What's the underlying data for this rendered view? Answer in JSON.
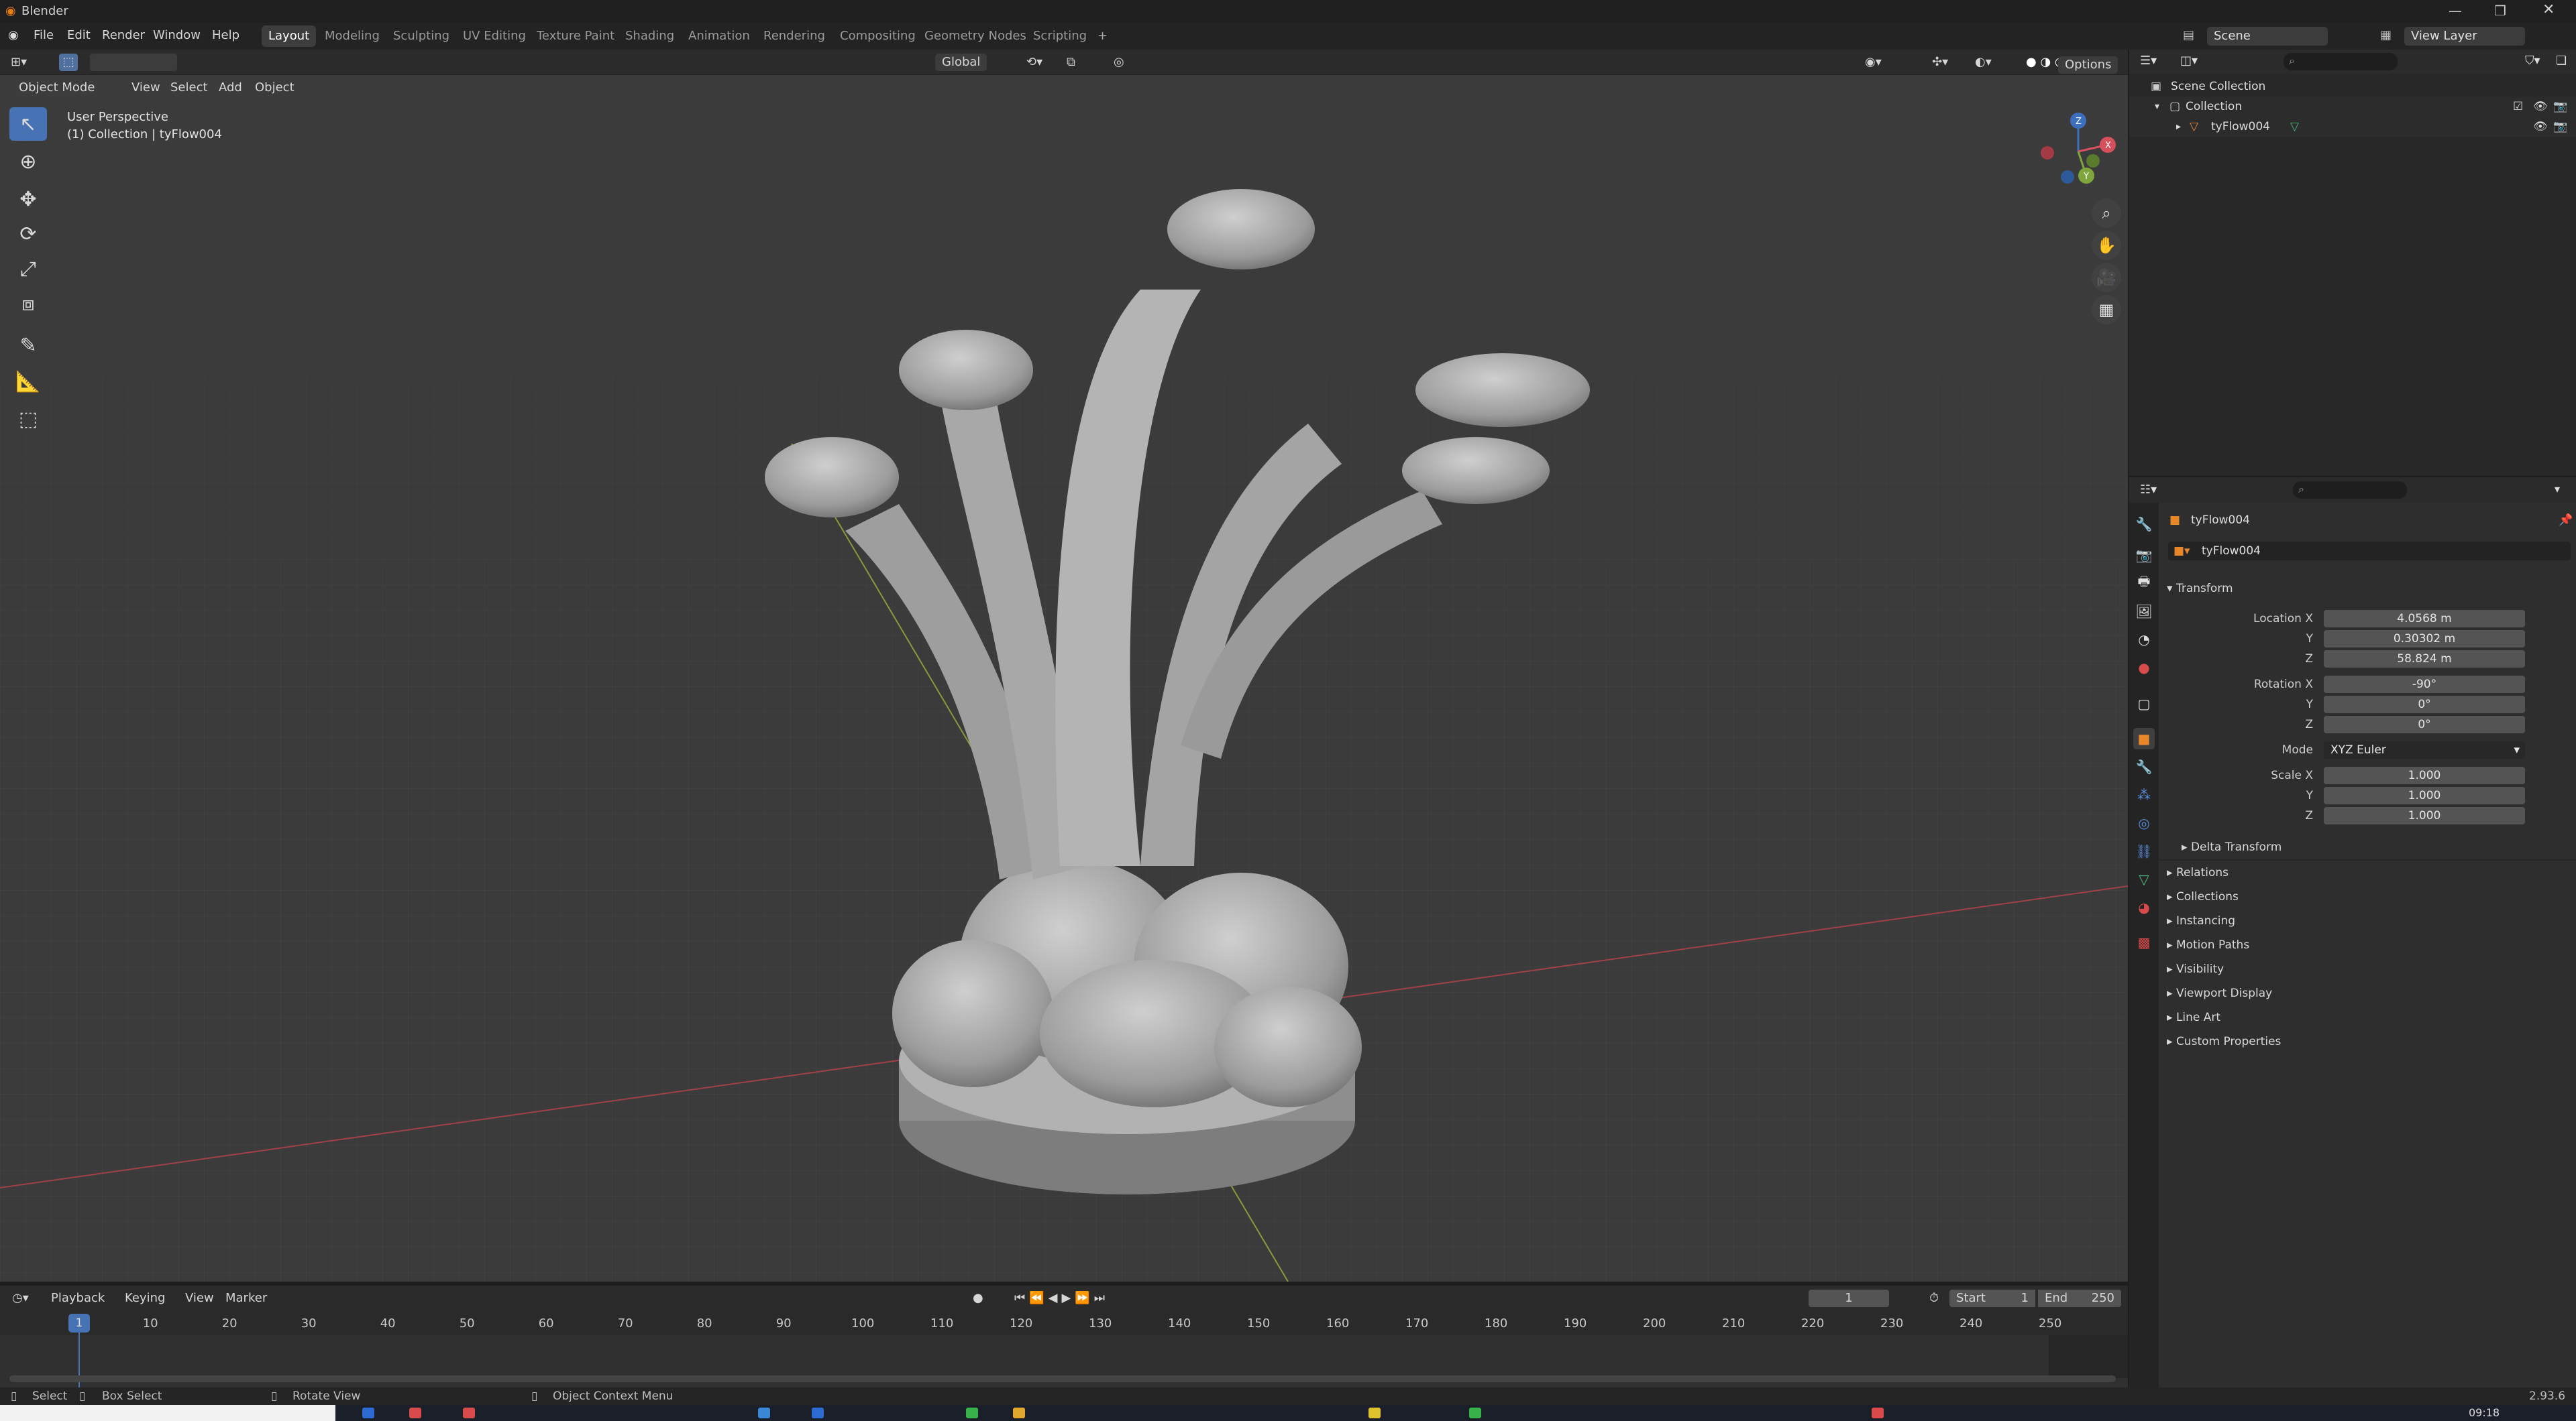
{
  "window": {
    "title": "Blender",
    "version": "2.93.6",
    "clock": "09:18"
  },
  "menu": {
    "items": [
      "File",
      "Edit",
      "Render",
      "Window",
      "Help"
    ]
  },
  "workspaces": [
    "Layout",
    "Modeling",
    "Sculpting",
    "UV Editing",
    "Texture Paint",
    "Shading",
    "Animation",
    "Rendering",
    "Compositing",
    "Geometry Nodes",
    "Scripting"
  ],
  "workspace_add": "+",
  "scene": {
    "name": "Scene",
    "view_layer": "View Layer"
  },
  "viewport_header": {
    "mode": "Object Mode",
    "menus": [
      "View",
      "Select",
      "Add",
      "Object"
    ],
    "orientation": "Global",
    "options": "Options"
  },
  "viewport": {
    "perspective_label": "User Perspective",
    "collection_label": "(1) Collection | tyFlow004",
    "gizmo": {
      "x": "X",
      "y": "Y",
      "z": "Z"
    }
  },
  "outliner": {
    "rows": [
      "Scene Collection",
      "Collection",
      "tyFlow004"
    ]
  },
  "properties": {
    "object_name": "tyFlow004",
    "data_name": "tyFlow004",
    "transform": {
      "section": "Transform",
      "location_label": "Location X",
      "rotation_label": "Rotation X",
      "mode_label": "Mode",
      "scale_label": "Scale X",
      "y_label": "Y",
      "z_label": "Z",
      "location": [
        "4.0568 m",
        "0.30302 m",
        "58.824 m"
      ],
      "rotation": [
        "-90°",
        "0°",
        "0°"
      ],
      "mode": "XYZ Euler",
      "scale": [
        "1.000",
        "1.000",
        "1.000"
      ]
    },
    "delta_transform": "Delta Transform",
    "sections": [
      "Relations",
      "Collections",
      "Instancing",
      "Motion Paths",
      "Visibility",
      "Viewport Display",
      "Line Art",
      "Custom Properties"
    ]
  },
  "timeline": {
    "menus": [
      "Playback",
      "Keying",
      "View",
      "Marker"
    ],
    "current_frame": "1",
    "start_label": "Start",
    "start": "1",
    "end_label": "End",
    "end": "250",
    "ticks": [
      "10",
      "20",
      "30",
      "40",
      "50",
      "60",
      "70",
      "80",
      "90",
      "100",
      "110",
      "120",
      "130",
      "140",
      "150",
      "160",
      "170",
      "180",
      "190",
      "200",
      "210",
      "220",
      "230",
      "240",
      "250"
    ],
    "playhead": "1"
  },
  "statusbar": {
    "select": "Select",
    "box_select": "Box Select",
    "rotate_view": "Rotate View",
    "context_menu": "Object Context Menu"
  }
}
